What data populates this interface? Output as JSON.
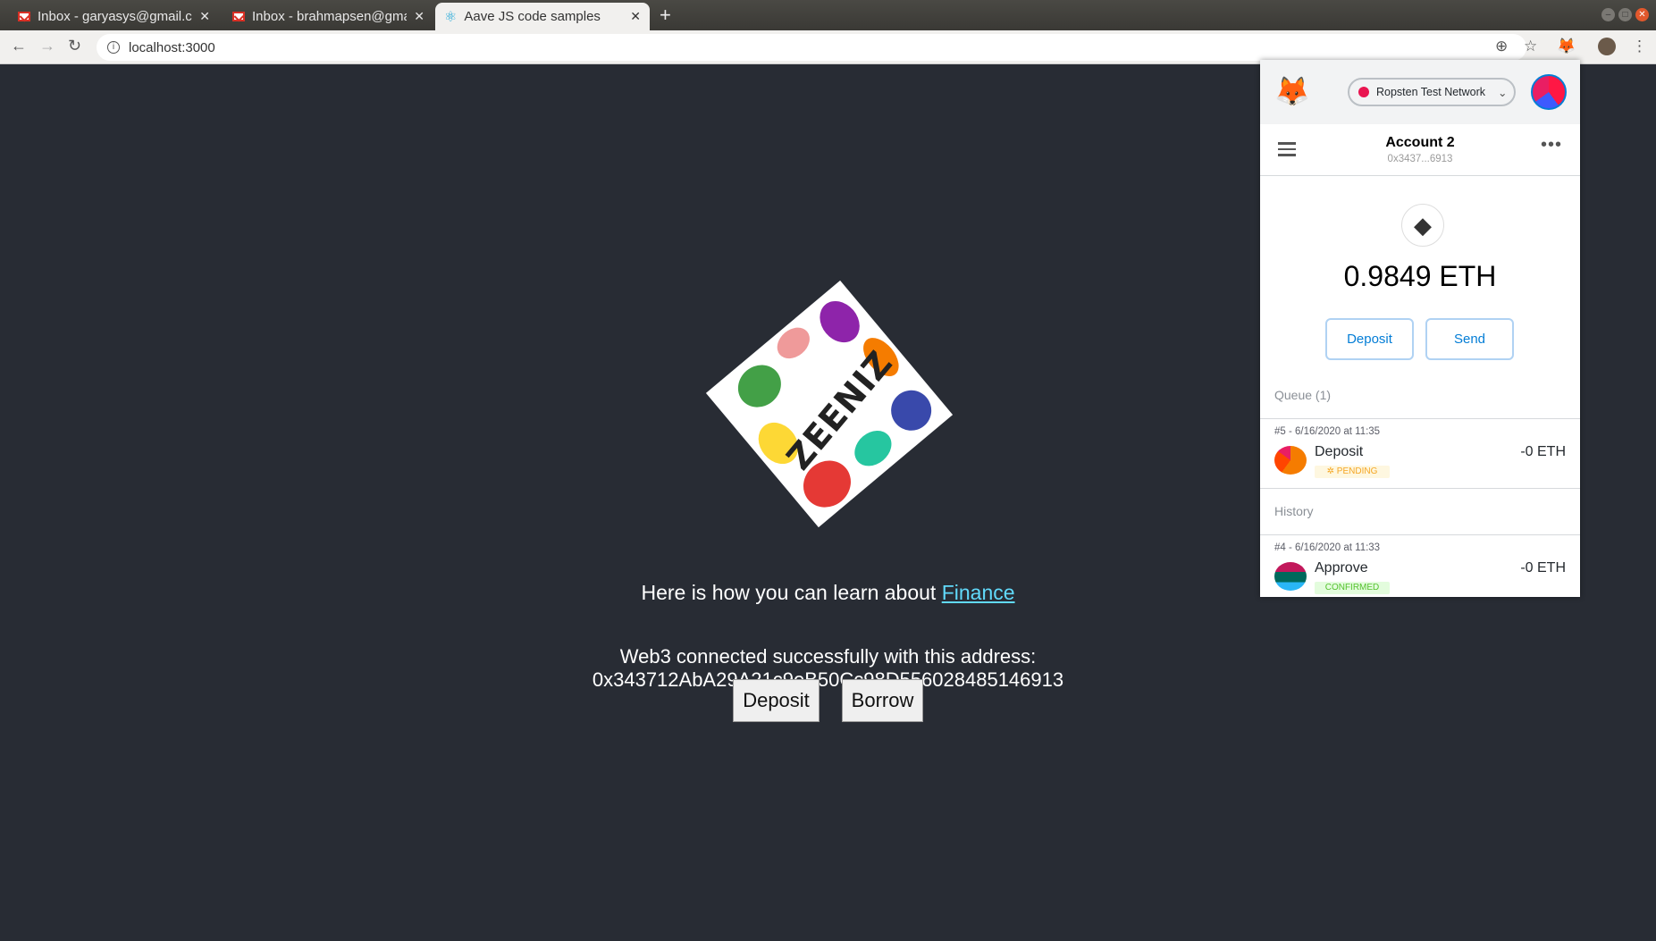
{
  "browser": {
    "tabs": [
      {
        "label": "Inbox - garyasys@gmail.com",
        "icon": "gmail-icon",
        "active": false
      },
      {
        "label": "Inbox - brahmapsen@gmail.com",
        "icon": "gmail-icon",
        "active": false
      },
      {
        "label": "Aave JS code samples",
        "icon": "react-icon",
        "active": true
      }
    ],
    "url": "localhost:3000"
  },
  "page": {
    "logo_text": "ZEENIZ",
    "learn_text": "Here is how you can learn about ",
    "learn_link": "Finance",
    "web3_line1": "Web3 connected successfully with this address:",
    "web3_address": "0x343712AbA29A21c9eB50Cc98D556028485146913",
    "deposit_label": "Deposit",
    "borrow_label": "Borrow",
    "background": "#282c34",
    "link_color": "#61dafb"
  },
  "metamask": {
    "network": "Ropsten Test Network",
    "account_name": "Account 2",
    "account_address": "0x3437...6913",
    "balance": "0.9849 ETH",
    "deposit_label": "Deposit",
    "send_label": "Send",
    "queue_label": "Queue (1)",
    "history_label": "History",
    "queue": [
      {
        "date": "#5 - 6/16/2020 at 11:35",
        "title": "Deposit",
        "amount": "-0 ETH",
        "status": "PENDING"
      }
    ],
    "history": [
      {
        "date": "#4 - 6/16/2020 at 11:33",
        "title": "Approve",
        "amount": "-0 ETH",
        "status": "CONFIRMED"
      }
    ]
  }
}
